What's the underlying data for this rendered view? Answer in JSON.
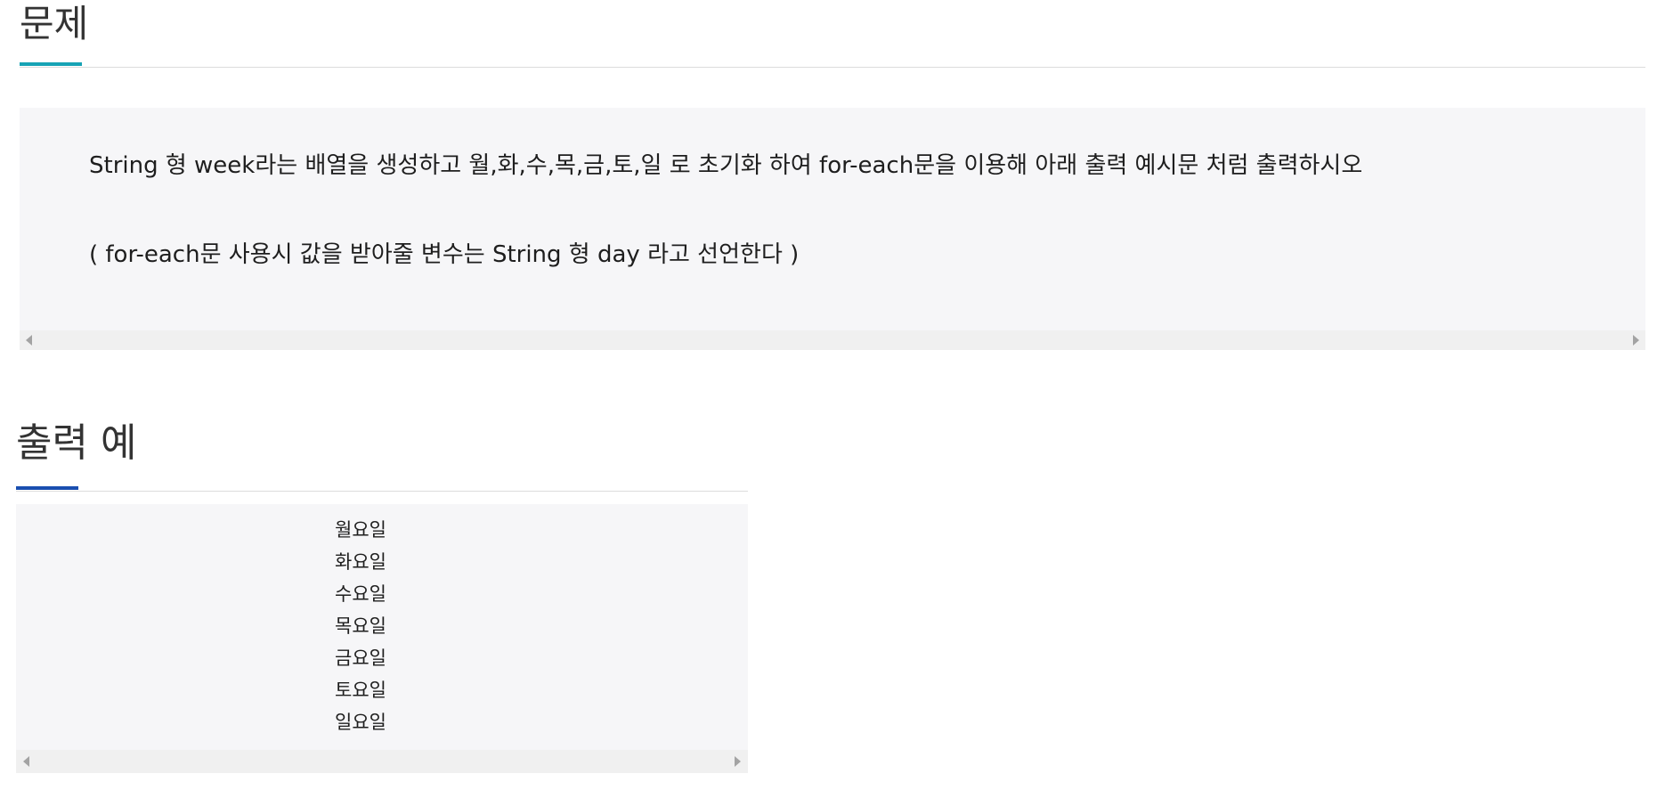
{
  "problem_section": {
    "title": "문제",
    "accent_color": "#17a3b5",
    "line1": "String 형 week라는 배열을 생성하고 월,화,수,목,금,토,일 로 초기화 하여 for-each문을 이용해 아래 출력 예시문 처럼 출력하시오",
    "line2": "( for-each문 사용시 값을 받아줄 변수는 String 형 day 라고 선언한다 )"
  },
  "output_section": {
    "title": "출력 예",
    "accent_color": "#1a4fb0",
    "lines": [
      "월요일",
      "화요일",
      "수요일",
      "목요일",
      "금요일",
      "토요일",
      "일요일"
    ]
  }
}
